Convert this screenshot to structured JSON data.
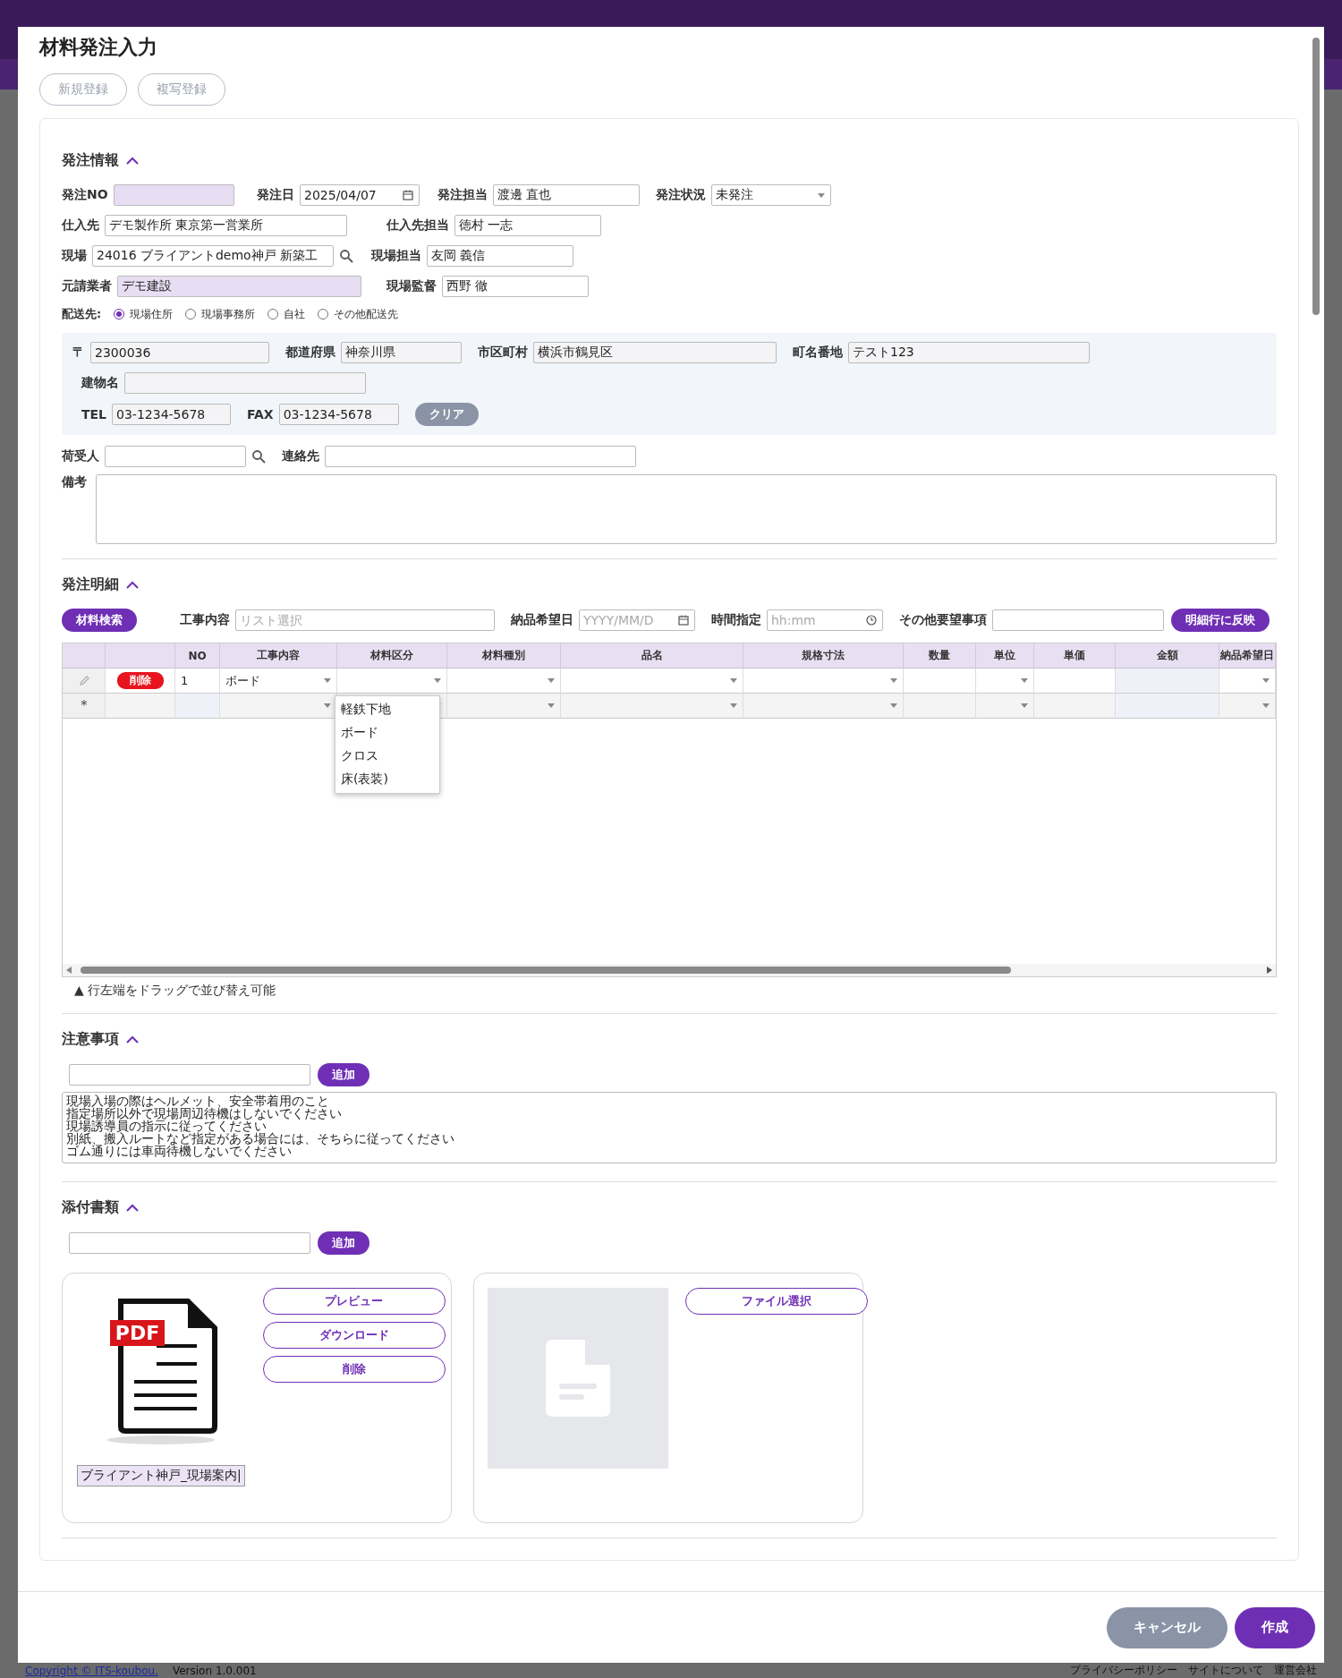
{
  "dialog": {
    "title": "材料発注入力",
    "toolbar_buttons": [
      {
        "label": "新規登録",
        "disabled": true
      },
      {
        "label": "複写登録",
        "disabled": true
      }
    ]
  },
  "order_info": {
    "heading": "発注情報",
    "expanded": true,
    "rows": [
      [
        {
          "label": "発注NO",
          "kind": "readonly"
        },
        {
          "label": "発注日",
          "kind": "date",
          "value": "2025/04/07"
        },
        {
          "label": "発注担当",
          "kind": "text",
          "value": "渡邊 直也"
        },
        {
          "label": "発注状況",
          "kind": "select",
          "value": "未発注"
        }
      ],
      [
        {
          "label": "仕入先",
          "kind": "text",
          "value": "デモ製作所 東京第一営業所"
        },
        {
          "label": "仕入先担当",
          "kind": "text",
          "value": "徳村 一志"
        }
      ],
      [
        {
          "label": "現場",
          "kind": "lookup",
          "value": "24016 ブライアントdemo神戸 新築工"
        },
        {
          "label": "現場担当",
          "kind": "text",
          "value": "友岡 義信"
        }
      ],
      [
        {
          "label": "元請業者",
          "kind": "readonly",
          "value": "デモ建設"
        },
        {
          "label": "現場監督",
          "kind": "text",
          "value": "西野 徹"
        }
      ]
    ],
    "delivery": {
      "label": "配送先:",
      "options": [
        {
          "label": "現場住所",
          "selected": true
        },
        {
          "label": "現場事務所",
          "selected": false
        },
        {
          "label": "自社",
          "selected": false
        },
        {
          "label": "その他配送先",
          "selected": false
        }
      ]
    },
    "address_rows": [
      [
        {
          "label": "〒",
          "kind": "readonly_grey",
          "value": "2300036"
        },
        {
          "label": "都道府県",
          "kind": "readonly_grey",
          "value": "神奈川県"
        },
        {
          "label": "市区町村",
          "kind": "readonly_grey",
          "value": "横浜市鶴見区"
        },
        {
          "label": "町名番地",
          "kind": "readonly_grey",
          "value": "テスト123"
        }
      ],
      [
        {
          "label": "建物名",
          "kind": "readonly_grey"
        }
      ],
      [
        {
          "label": "TEL",
          "kind": "readonly_grey",
          "value": "03-1234-5678"
        },
        {
          "label": "FAX",
          "kind": "readonly_grey",
          "value": "03-1234-5678"
        }
      ]
    ],
    "clear_button": "クリア",
    "contact_row": [
      {
        "label": "荷受人",
        "kind": "lookup"
      },
      {
        "label": "連絡先",
        "kind": "text"
      }
    ],
    "remarks": {
      "label": "備考"
    }
  },
  "order_details": {
    "heading": "発注明細",
    "expanded": true,
    "search_button": "材料検索",
    "filters": [
      {
        "label": "工事内容",
        "placeholder": "リスト選択",
        "kind": "text"
      },
      {
        "label": "納品希望日",
        "placeholder": "YYYY/MM/D",
        "kind": "date"
      },
      {
        "label": "時間指定",
        "placeholder": "hh:mm",
        "kind": "time"
      },
      {
        "label": "その他要望事項",
        "kind": "text"
      }
    ],
    "apply_button": "明細行に反映",
    "columns": [
      {
        "label": "NO",
        "kind": "number"
      },
      {
        "label": "工事内容",
        "kind": "select"
      },
      {
        "label": "材料区分",
        "kind": "select"
      },
      {
        "label": "材料種別",
        "kind": "select"
      },
      {
        "label": "品名",
        "kind": "select"
      },
      {
        "label": "規格寸法",
        "kind": "select"
      },
      {
        "label": "数量",
        "kind": "text"
      },
      {
        "label": "単位",
        "kind": "select"
      },
      {
        "label": "単価",
        "kind": "text"
      },
      {
        "label": "金額",
        "kind": "readonly"
      },
      {
        "label": "納品希望日",
        "kind": "select"
      }
    ],
    "rows": [
      {
        "kind": "data",
        "delete_label": "削除",
        "cells": [
          "1",
          "ボード",
          "",
          "",
          "",
          "",
          "",
          "",
          "",
          "",
          ""
        ]
      },
      {
        "kind": "new",
        "marker": "＊",
        "cells": [
          "",
          "",
          "",
          "",
          "",
          "",
          "",
          "",
          "",
          "",
          ""
        ]
      }
    ],
    "dropdown": {
      "options": [
        "軽鉄下地",
        "ボード",
        "クロス",
        "床(表装)"
      ]
    },
    "note": "▲ 行左端をドラッグで並び替え可能"
  },
  "notices": {
    "heading": "注意事項",
    "expanded": true,
    "add_button": "追加",
    "lines": [
      "現場入場の際はヘルメット、安全帯着用のこと",
      "指定場所以外で現場周辺待機はしないでください",
      "現場誘導員の指示に従ってください",
      "別紙、搬入ルートなど指定がある場合には、そちらに従ってください",
      "ゴム通りには車両待機しないでください"
    ]
  },
  "attachments": {
    "heading": "添付書類",
    "expanded": true,
    "add_button": "追加",
    "files": [
      {
        "kind": "pdf",
        "badge": "PDF",
        "file_name": "ブライアント神戸_現場案内|",
        "buttons": [
          "プレビュー",
          "ダウンロード",
          "削除"
        ]
      },
      {
        "kind": "empty",
        "buttons": [
          "ファイル選択"
        ]
      }
    ]
  },
  "actions": [
    {
      "label": "キャンセル",
      "kind": "secondary"
    },
    {
      "label": "作成",
      "kind": "primary"
    }
  ],
  "page_footer": {
    "copyright": "Copyright © ITS-koubou.",
    "version": "Version 1.0.001",
    "links": [
      "プライバシーポリシー",
      "サイトについて",
      "運営会社"
    ]
  }
}
